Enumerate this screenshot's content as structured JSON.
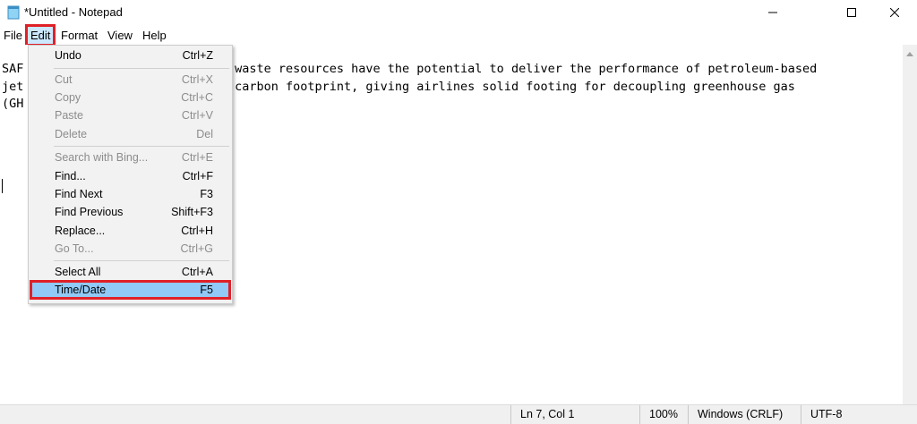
{
  "window": {
    "title": "*Untitled - Notepad",
    "controls": {
      "minimize": "—",
      "maximize": "☐",
      "close": "✕"
    }
  },
  "menubar": {
    "items": [
      "File",
      "Edit",
      "Format",
      "View",
      "Help"
    ],
    "active": "Edit"
  },
  "editor": {
    "lines": [
      "SAF                       s and waste resources have the potential to deliver the performance of petroleum-based",
      "jet                       f its carbon footprint, giving airlines solid footing for decoupling greenhouse gas",
      "(GH"
    ]
  },
  "edit_menu": {
    "items": [
      {
        "label": "Undo",
        "shortcut": "Ctrl+Z",
        "enabled": true
      },
      {
        "label": "Cut",
        "shortcut": "Ctrl+X",
        "enabled": false
      },
      {
        "label": "Copy",
        "shortcut": "Ctrl+C",
        "enabled": false
      },
      {
        "label": "Paste",
        "shortcut": "Ctrl+V",
        "enabled": false
      },
      {
        "label": "Delete",
        "shortcut": "Del",
        "enabled": false
      },
      {
        "label": "Search with Bing...",
        "shortcut": "Ctrl+E",
        "enabled": false
      },
      {
        "label": "Find...",
        "shortcut": "Ctrl+F",
        "enabled": true
      },
      {
        "label": "Find Next",
        "shortcut": "F3",
        "enabled": true
      },
      {
        "label": "Find Previous",
        "shortcut": "Shift+F3",
        "enabled": true
      },
      {
        "label": "Replace...",
        "shortcut": "Ctrl+H",
        "enabled": true
      },
      {
        "label": "Go To...",
        "shortcut": "Ctrl+G",
        "enabled": false
      },
      {
        "label": "Select All",
        "shortcut": "Ctrl+A",
        "enabled": true
      },
      {
        "label": "Time/Date",
        "shortcut": "F5",
        "enabled": true,
        "highlighted": true
      }
    ]
  },
  "statusbar": {
    "position": "Ln 7, Col 1",
    "zoom": "100%",
    "line_endings": "Windows (CRLF)",
    "encoding": "UTF-8"
  },
  "colors": {
    "highlight_outline": "#e02027",
    "menu_highlight": "#91c9f7"
  }
}
